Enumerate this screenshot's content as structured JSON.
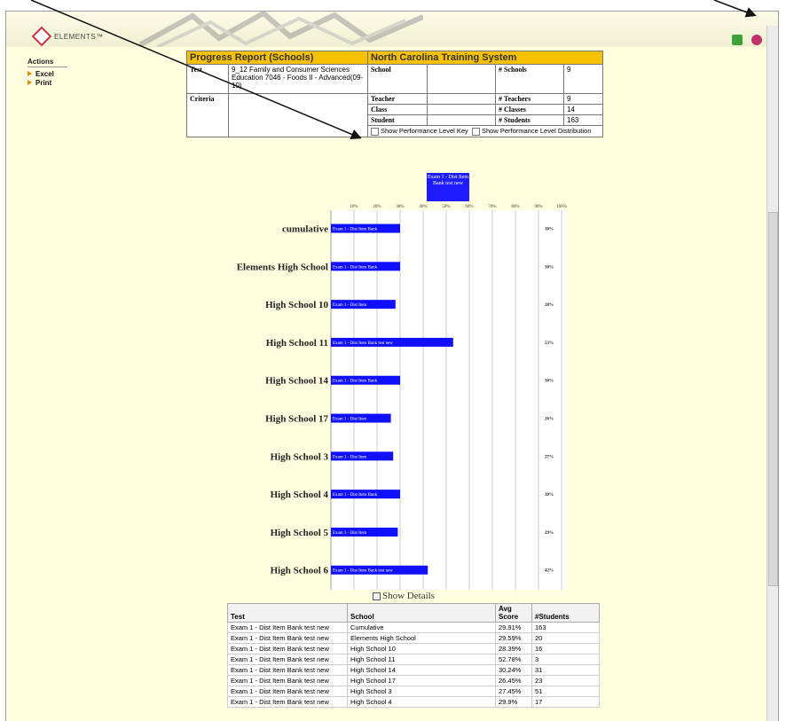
{
  "app": {
    "logo_text": "ELEMENTS™"
  },
  "sidebar": {
    "title": "Actions",
    "items": [
      {
        "label": "Excel"
      },
      {
        "label": "Print"
      }
    ]
  },
  "report": {
    "title": "Progress Report (Schools)",
    "org": "North Carolina Training System",
    "test_label": "Test",
    "test_value": "9_12 Family and Consumer Sciences Education 7046 - Foods II - Advanced(09-10)",
    "criteria_label": "Criteria",
    "school_label": "School",
    "teacher_label": "Teacher",
    "class_label": "Class",
    "student_label": "Student",
    "schools_count_label": "# Schools",
    "schools_count": "9",
    "teachers_count_label": "# Teachers",
    "teachers_count": "9",
    "classes_count_label": "# Classes",
    "classes_count": "14",
    "students_count_label": "# Students",
    "students_count": "163",
    "opt_key": "Show Performance Level Key",
    "opt_dist": "Show Performance Level Distribution"
  },
  "chart_data": {
    "type": "bar",
    "orientation": "horizontal",
    "legend": "Exam 1 - Dist Item Bank test new",
    "x_ticks": [
      "10%",
      "20%",
      "30%",
      "40%",
      "50%",
      "60%",
      "70%",
      "80%",
      "90%",
      "100%"
    ],
    "xlim": [
      0,
      100
    ],
    "bar_color": "#1010ff",
    "categories": [
      "cumulative",
      "Elements High School",
      "High School 10",
      "High School 11",
      "High School 14",
      "High School 17",
      "High School 3",
      "High School 4",
      "High School 5",
      "High School 6"
    ],
    "values": [
      30,
      30,
      28,
      53,
      30,
      26,
      27,
      30,
      29,
      42
    ],
    "value_labels": [
      "30%",
      "30%",
      "28%",
      "53%",
      "30%",
      "26%",
      "27%",
      "30%",
      "29%",
      "42%"
    ],
    "bar_labels": [
      "Exam 1 - Dist Item Bank",
      "Exam 1 - Dist Item Bank",
      "Exam 1 - Dist Item",
      "Exam 1 - Dist Item Bank test new",
      "Exam 1 - Dist Item Bank",
      "Exam 1 - Dist Item",
      "Exam 1 - Dist Item",
      "Exam 1 - Dist Item Bank",
      "Exam 1 - Dist Item",
      "Exam 1 - Dist Item Bank test new"
    ]
  },
  "details": {
    "toggle_label": "Show Details",
    "headers": [
      "Test",
      "School",
      "Avg Score",
      "#Students"
    ],
    "rows": [
      [
        "Exam 1 - Dist Item Bank test new",
        "Cumulative",
        "29.91%",
        "163"
      ],
      [
        "Exam 1 - Dist Item Bank test new",
        "Elements High School",
        "29.59%",
        "20"
      ],
      [
        "Exam 1 - Dist Item Bank test new",
        "High School 10",
        "28.39%",
        "16"
      ],
      [
        "Exam 1 - Dist Item Bank test new",
        "High School 11",
        "52.78%",
        "3"
      ],
      [
        "Exam 1 - Dist Item Bank test new",
        "High School 14",
        "30.24%",
        "31"
      ],
      [
        "Exam 1 - Dist Item Bank test new",
        "High School 17",
        "26.45%",
        "23"
      ],
      [
        "Exam 1 - Dist Item Bank test new",
        "High School 3",
        "27.45%",
        "51"
      ],
      [
        "Exam 1 - Dist Item Bank test new",
        "High School 4",
        "29.9%",
        "17"
      ]
    ]
  },
  "colors": {
    "accent": "#f7c000",
    "page_bg": "#ffffe0",
    "bar": "#1010ff"
  }
}
